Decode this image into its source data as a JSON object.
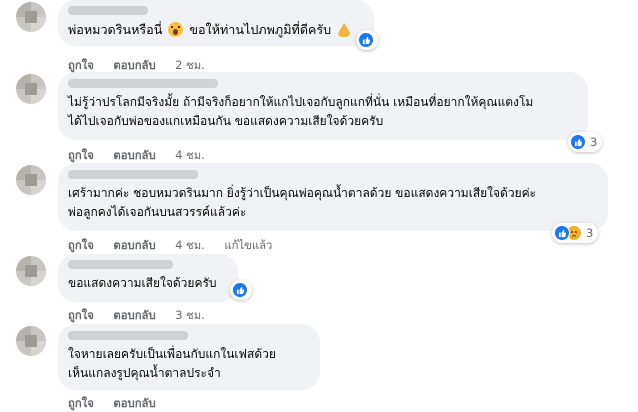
{
  "comments": [
    {
      "lines": [
        "พ่อหมวดรินหรือนี่",
        "ขอให้ท่านไปภพภูมิที่ดีครับ"
      ],
      "actions": {
        "like": "ถูกใจ",
        "reply": "ตอบกลับ",
        "time": "2 ชม."
      },
      "reaction": {
        "icons": [
          "like-icon"
        ],
        "count": ""
      },
      "emojis": [
        "shocked-face-emoji",
        "folded-hands-emoji"
      ]
    },
    {
      "lines": [
        "ไม่รู้ว่าปรโลกมีจริงมั้ย ถ้ามีจริงก็อยากให้แกไปเจอกับลูกแกที่นั่น เหมือนที่อยากให้คุณแตงโม",
        "ได้ไปเจอกับพ่อของแกเหมือนกัน ขอแสดงความเสียใจด้วยครับ"
      ],
      "actions": {
        "like": "ถูกใจ",
        "reply": "ตอบกลับ",
        "time": "4 ชม."
      },
      "reaction": {
        "icons": [
          "like-icon"
        ],
        "count": "3"
      }
    },
    {
      "lines": [
        "เศร้ามากค่ะ ชอบหมวดรินมาก ยิ่งรู้ว่าเป็นคุณพ่อคุณน้ำตาลด้วย ขอแสดงความเสียใจด้วยค่ะ",
        "พ่อลูกคงได้เจอกันบนสวรรค์แล้วค่ะ"
      ],
      "actions": {
        "like": "ถูกใจ",
        "reply": "ตอบกลับ",
        "time": "4 ชม.",
        "edited": "แก้ไขแล้ว"
      },
      "reaction": {
        "icons": [
          "like-icon",
          "sad-icon"
        ],
        "count": "3"
      }
    },
    {
      "lines": [
        "ขอแสดงความเสียใจด้วยครับ"
      ],
      "actions": {
        "like": "ถูกใจ",
        "reply": "ตอบกลับ",
        "time": "3 ชม."
      },
      "reaction": {
        "icons": [
          "like-icon"
        ],
        "count": ""
      }
    },
    {
      "lines": [
        "ใจหายเลยครับเป็นเพื่อนกับแกในเฟสด้วย",
        "เห็นแกลงรูปคุณน้ำตาลประจำ"
      ],
      "actions": {
        "like": "ถูกใจ",
        "reply": "ตอบกลับ",
        "time": ""
      }
    }
  ],
  "colors": {
    "bubble": "#f0f2f5",
    "like": "#1877f2",
    "sad": "#f7b125",
    "meta": "#65676b"
  }
}
